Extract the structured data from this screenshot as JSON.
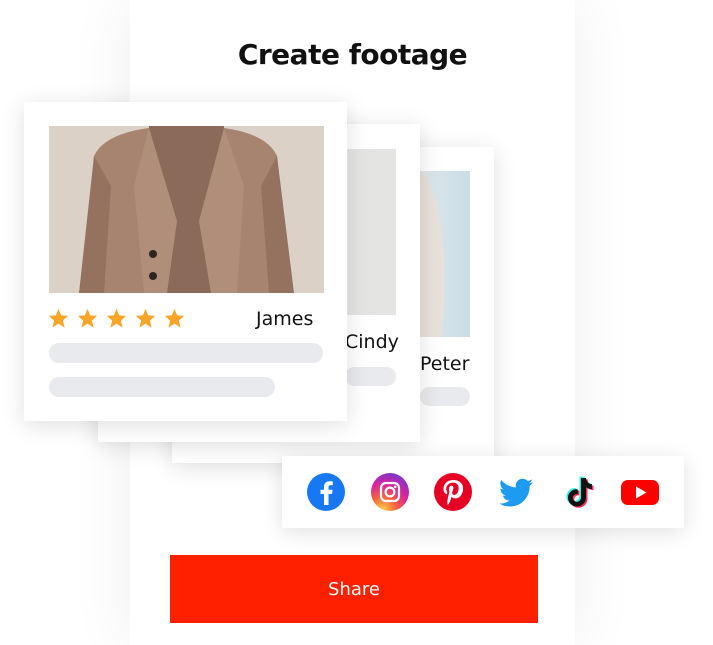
{
  "title": "Create footage",
  "cards": [
    {
      "name": "Peter"
    },
    {
      "name": "Cindy"
    },
    {
      "name": "James",
      "rating": 5,
      "rating_max": 5
    }
  ],
  "social_icons": [
    "facebook-icon",
    "instagram-icon",
    "pinterest-icon",
    "twitter-icon",
    "tiktok-icon",
    "youtube-icon"
  ],
  "share_button": {
    "label": "Share"
  },
  "colors": {
    "accent": "#ff2000",
    "star": "#f7a428",
    "placeholder_bar": "#e9eaed",
    "facebook": "#1877f2",
    "pinterest": "#e60023",
    "twitter": "#1d9bf0",
    "youtube": "#ff0000"
  }
}
